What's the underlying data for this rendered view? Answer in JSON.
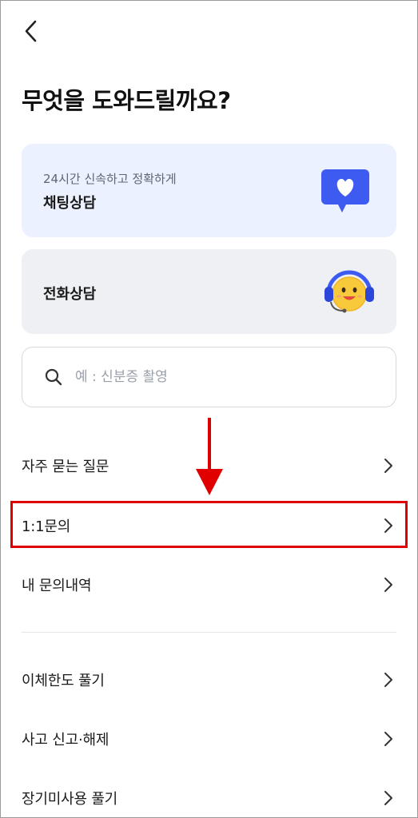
{
  "header": {
    "title": "무엇을 도와드릴까요?"
  },
  "chat_card": {
    "subtitle": "24시간 신속하고 정확하게",
    "title": "채팅상담"
  },
  "phone_card": {
    "title": "전화상담"
  },
  "search": {
    "placeholder": "예 : 신분증 촬영",
    "value": ""
  },
  "menu_primary": [
    {
      "label": "자주 묻는 질문"
    },
    {
      "label": "1:1문의"
    },
    {
      "label": "내 문의내역"
    }
  ],
  "menu_secondary": [
    {
      "label": "이체한도 풀기"
    },
    {
      "label": "사고 신고·해제"
    },
    {
      "label": "장기미사용 풀기"
    }
  ],
  "colors": {
    "highlight": "#e00000",
    "chat_card_bg": "#ebf1fe",
    "phone_card_bg": "#eef0f3",
    "chat_icon": "#3d5af1"
  }
}
